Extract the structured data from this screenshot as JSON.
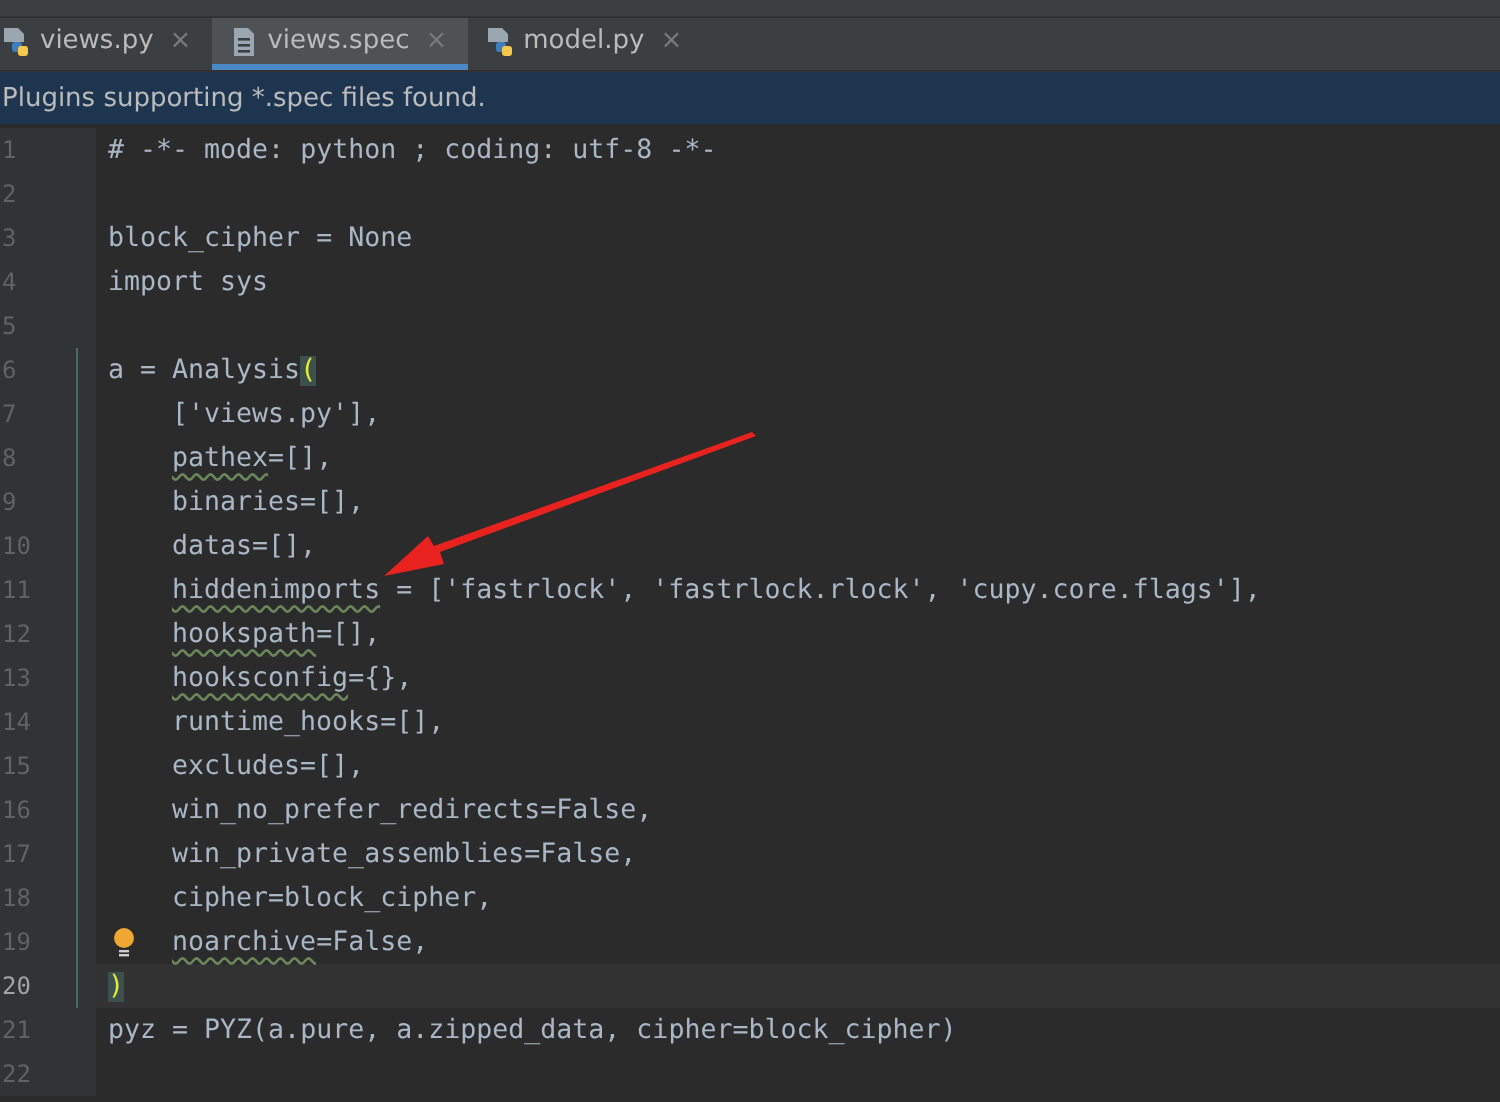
{
  "tabs": [
    {
      "label": "views.py",
      "kind": "python",
      "selected": false,
      "close": "×"
    },
    {
      "label": "views.spec",
      "kind": "spec",
      "selected": true,
      "close": "×"
    },
    {
      "label": "model.py",
      "kind": "python",
      "selected": false,
      "close": "×"
    }
  ],
  "notification": "Plugins supporting *.spec files found.",
  "editor": {
    "lines": [
      {
        "number": "1",
        "current": false,
        "scope": false,
        "bulb": false,
        "indented": false,
        "segments": [
          {
            "text": "# -*- mode: python ; coding: utf-8 -*-",
            "kind": "plain"
          }
        ]
      },
      {
        "number": "2",
        "current": false,
        "scope": false,
        "bulb": false
      },
      {
        "number": "3",
        "current": false,
        "scope": false,
        "bulb": false,
        "indented": false,
        "segments": [
          {
            "text": "block_cipher = None",
            "kind": "plain"
          }
        ]
      },
      {
        "number": "4",
        "current": false,
        "scope": false,
        "bulb": false,
        "indented": false,
        "segments": [
          {
            "text": "import sys",
            "kind": "plain"
          }
        ]
      },
      {
        "number": "5",
        "current": false,
        "scope": false,
        "bulb": false
      },
      {
        "number": "6",
        "current": false,
        "scope": true,
        "bulb": false,
        "indented": false,
        "segments": [
          {
            "text": "a = Analysis",
            "kind": "plain"
          },
          {
            "text": "(",
            "kind": "brace"
          }
        ]
      },
      {
        "number": "7",
        "current": false,
        "scope": true,
        "bulb": false,
        "indented": true,
        "segments": [
          {
            "text": "['views.py'],",
            "kind": "plain"
          }
        ]
      },
      {
        "number": "8",
        "current": false,
        "scope": true,
        "bulb": false,
        "indented": true,
        "segments": [
          {
            "text": "pathex",
            "kind": "warning"
          },
          {
            "text": "=[],",
            "kind": "plain"
          }
        ]
      },
      {
        "number": "9",
        "current": false,
        "scope": true,
        "bulb": false,
        "indented": true,
        "segments": [
          {
            "text": "binaries=[],",
            "kind": "plain"
          }
        ]
      },
      {
        "number": "10",
        "current": false,
        "scope": true,
        "bulb": false,
        "indented": true,
        "segments": [
          {
            "text": "datas=[],",
            "kind": "plain"
          }
        ]
      },
      {
        "number": "11",
        "current": false,
        "scope": true,
        "bulb": false,
        "indented": true,
        "segments": [
          {
            "text": "hiddenimports",
            "kind": "warning"
          },
          {
            "text": " = ['fastrlock', 'fastrlock.rlock', 'cupy.core.flags'],",
            "kind": "plain"
          }
        ]
      },
      {
        "number": "12",
        "current": false,
        "scope": true,
        "bulb": false,
        "indented": true,
        "segments": [
          {
            "text": "hookspath",
            "kind": "warning"
          },
          {
            "text": "=[],",
            "kind": "plain"
          }
        ]
      },
      {
        "number": "13",
        "current": false,
        "scope": true,
        "bulb": false,
        "indented": true,
        "segments": [
          {
            "text": "hooksconfig",
            "kind": "warning"
          },
          {
            "text": "={},",
            "kind": "plain"
          }
        ]
      },
      {
        "number": "14",
        "current": false,
        "scope": true,
        "bulb": false,
        "indented": true,
        "segments": [
          {
            "text": "runtime_hooks=[],",
            "kind": "plain"
          }
        ]
      },
      {
        "number": "15",
        "current": false,
        "scope": true,
        "bulb": false,
        "indented": true,
        "segments": [
          {
            "text": "excludes=[],",
            "kind": "plain"
          }
        ]
      },
      {
        "number": "16",
        "current": false,
        "scope": true,
        "bulb": false,
        "indented": true,
        "segments": [
          {
            "text": "win_no_prefer_redirects=False,",
            "kind": "plain"
          }
        ]
      },
      {
        "number": "17",
        "current": false,
        "scope": true,
        "bulb": false,
        "indented": true,
        "segments": [
          {
            "text": "win_private_assemblies=False,",
            "kind": "plain"
          }
        ]
      },
      {
        "number": "18",
        "current": false,
        "scope": true,
        "bulb": false,
        "indented": true,
        "segments": [
          {
            "text": "cipher=block_cipher,",
            "kind": "plain"
          }
        ]
      },
      {
        "number": "19",
        "current": false,
        "scope": true,
        "bulb": true,
        "indented": true,
        "segments": [
          {
            "text": "noarchive",
            "kind": "warning"
          },
          {
            "text": "=False,",
            "kind": "plain"
          }
        ]
      },
      {
        "number": "20",
        "current": true,
        "scope": true,
        "bulb": false,
        "indented": false,
        "segments": [
          {
            "text": ")",
            "kind": "brace"
          }
        ]
      },
      {
        "number": "21",
        "current": false,
        "scope": false,
        "bulb": false,
        "indented": false,
        "segments": [
          {
            "text": "pyz = PYZ(a.pure, a.zipped_data, cipher=block_cipher)",
            "kind": "plain"
          }
        ]
      },
      {
        "number": "22",
        "current": false,
        "scope": false,
        "bulb": false
      }
    ]
  },
  "annotation": {
    "kind": "arrow"
  }
}
